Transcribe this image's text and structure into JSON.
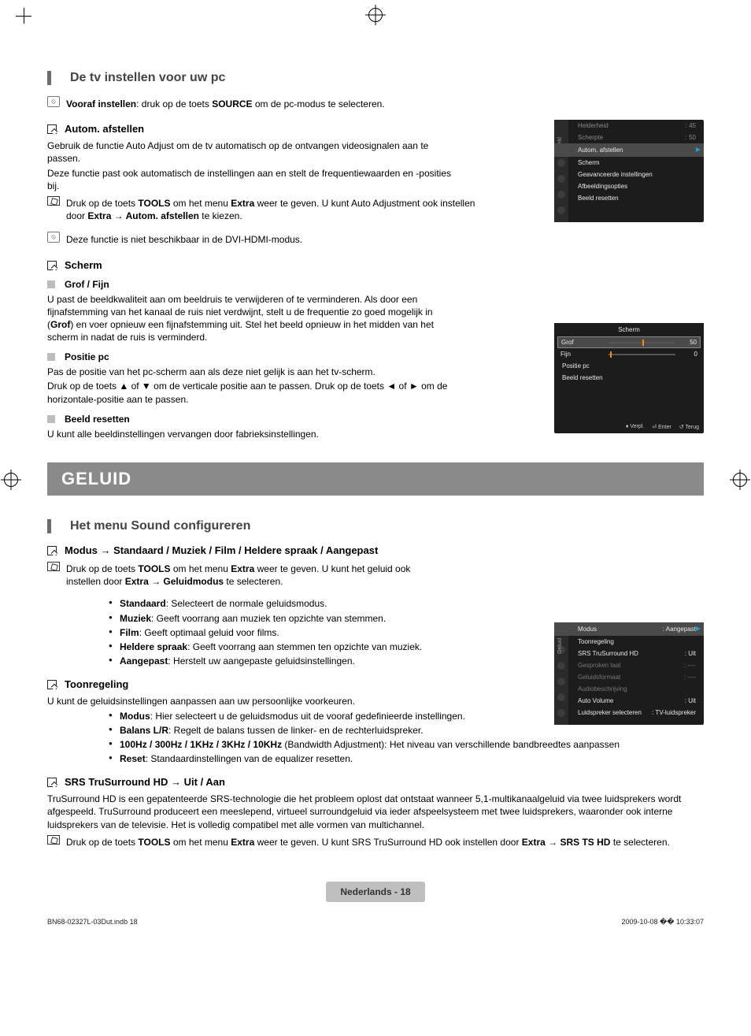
{
  "headings": {
    "pc_setup": "De tv instellen voor uw pc",
    "sound_config": "Het menu Sound configureren"
  },
  "banner": {
    "geluid": "GELUID"
  },
  "pc": {
    "preset_note_pre": "Vooraf instellen",
    "preset_note_mid": ": druk op de toets ",
    "preset_note_key": "SOURCE",
    "preset_note_post": " om de pc-modus te selecteren.",
    "autom_title": "Autom. afstellen",
    "autom_p1": "Gebruik de functie Auto Adjust om de tv automatisch op de ontvangen videosignalen aan te passen.",
    "autom_p2": "Deze functie past ook automatisch de instellingen aan en stelt de frequentiewaarden en -posities bij.",
    "autom_tools_pre": "Druk op de toets ",
    "autom_tools_key1": "TOOLS",
    "autom_tools_mid": " om het menu ",
    "autom_tools_key2": "Extra",
    "autom_tools_post": " weer te geven. U kunt Auto Adjustment ook instellen door ",
    "autom_tools_path": "Extra → Autom. afstellen",
    "autom_tools_end": " te kiezen.",
    "autom_note2": "Deze functie is niet beschikbaar in de DVI-HDMI-modus.",
    "scherm_title": "Scherm",
    "grof_title": "Grof / Fijn",
    "grof_p_pre": "U past de beeldkwaliteit aan om beeldruis te verwijderen of te verminderen. Als door een fijnafstemming van het kanaal de ruis niet verdwijnt, stelt u de frequentie zo goed mogelijk in (",
    "grof_p_bold": "Grof",
    "grof_p_post": ") en voer opnieuw een fijnafstemming uit. Stel het beeld opnieuw in het midden van het scherm in nadat de ruis is verminderd.",
    "positie_title": "Positie pc",
    "positie_p1": "Pas de positie van het pc-scherm aan als deze niet gelijk is aan het tv-scherm.",
    "positie_p2": "Druk op de toets ▲ of ▼ om de verticale positie aan te passen. Druk op de toets ◄ of ► om de horizontale-positie aan te passen.",
    "beeldreset_title": "Beeld resetten",
    "beeldreset_p": "U kunt alle beeldinstellingen vervangen door fabrieksinstellingen."
  },
  "sound": {
    "modus_title": "Modus → Standaard / Muziek / Film / Heldere spraak / Aangepast",
    "modus_tools_pre": "Druk op de toets ",
    "modus_tools_key1": "TOOLS",
    "modus_tools_mid": " om het menu ",
    "modus_tools_key2": "Extra",
    "modus_tools_post": " weer te geven. U kunt het geluid ook instellen door ",
    "modus_tools_path": "Extra → Geluidmodus",
    "modus_tools_end": " te selecteren.",
    "li_standaard_b": "Standaard",
    "li_standaard_t": ": Selecteert de normale geluidsmodus.",
    "li_muziek_b": "Muziek",
    "li_muziek_t": ": Geeft voorrang aan muziek ten opzichte van stemmen.",
    "li_film_b": "Film",
    "li_film_t": ": Geeft optimaal geluid voor films.",
    "li_heldere_b": "Heldere spraak",
    "li_heldere_t": ": Geeft voorrang aan stemmen ten opzichte van muziek.",
    "li_aangepast_b": "Aangepast",
    "li_aangepast_t": ": Herstelt uw aangepaste geluidsinstellingen.",
    "toon_title": "Toonregeling",
    "toon_p": "U kunt de geluidsinstellingen aanpassen aan uw persoonlijke voorkeuren.",
    "toon_li_modus_b": "Modus",
    "toon_li_modus_t": ": Hier selecteert u de geluidsmodus uit de vooraf gedefinieerde instellingen.",
    "toon_li_balans_b": "Balans L/R",
    "toon_li_balans_t": ": Regelt de balans tussen de linker- en de rechterluidspreker.",
    "toon_li_hz_b": "100Hz / 300Hz / 1KHz / 3KHz / 10KHz",
    "toon_li_hz_t": " (Bandwidth Adjustment): Het niveau van verschillende bandbreedtes aanpassen",
    "toon_li_reset_b": "Reset",
    "toon_li_reset_t": ": Standaardinstellingen van de equalizer resetten.",
    "srs_title": "SRS TruSurround HD → Uit / Aan",
    "srs_p": "TruSurround HD is een gepatenteerde SRS-technologie die het probleem oplost dat ontstaat wanneer 5,1-multikanaalgeluid via twee luidsprekers wordt afgespeeld. TruSurround produceert een meeslepend, virtueel surroundgeluid via ieder afspeelsysteem met twee luidsprekers, waaronder ook interne luidsprekers van de televisie. Het is volledig compatibel met alle vormen van multichannel.",
    "srs_tools_pre": "Druk op de toets ",
    "srs_tools_key1": "TOOLS",
    "srs_tools_mid": " om het menu ",
    "srs_tools_key2": "Extra",
    "srs_tools_post": " weer te geven. U kunt SRS TruSurround HD ook instellen door ",
    "srs_tools_path": "Extra → SRS TS HD",
    "srs_tools_end": " te selecteren."
  },
  "tv1": {
    "side_label": "Beeld",
    "r1_label": "Helderheid",
    "r1_val": ": 45",
    "r2_label": "Scherpte",
    "r2_val": ": 50",
    "sel": "Autom. afstellen",
    "i1": "Scherm",
    "i2": "Geavanceerde instellingen",
    "i3": "Afbeeldingsopties",
    "i4": "Beeld resetten"
  },
  "tv2": {
    "title": "Scherm",
    "grof_label": "Grof",
    "grof_val": "50",
    "fijn_label": "Fijn",
    "fijn_val": "0",
    "pos": "Positie pc",
    "reset": "Beeld resetten",
    "foot_move": "Verpl.",
    "foot_enter": "Enter",
    "foot_return": "Terug"
  },
  "tv3": {
    "side_label": "Geluid",
    "sel_label": "Modus",
    "sel_val": ": Aangepast",
    "i1": "Toonregeling",
    "i2_label": "SRS TruSurround HD",
    "i2_val": ": Uit",
    "i3_label": "Gesproken taal",
    "i3_val": ": ----",
    "i4_label": "Geluidsformaat",
    "i4_val": ": ----",
    "i5": "Audiobeschrijving",
    "i6_label": "Auto Volume",
    "i6_val": ": Uit",
    "i7_label": "Luidspreker selecteren",
    "i7_val": ": TV-luidspreker"
  },
  "footer": {
    "page_badge": "Nederlands - 18",
    "doc_left": "BN68-02327L-03Dut.indb   18",
    "doc_right": "2009-10-08   �� 10:33:07"
  }
}
